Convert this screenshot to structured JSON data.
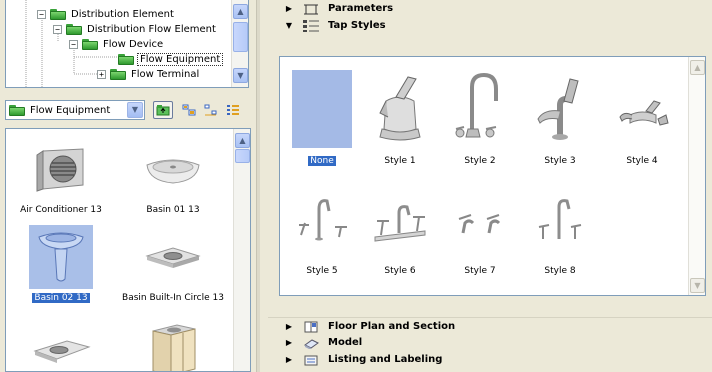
{
  "tree": {
    "items": [
      {
        "label": "Distribution Element",
        "expander": "−"
      },
      {
        "label": "Distribution Flow Element",
        "expander": "−"
      },
      {
        "label": "Flow Device",
        "expander": "−"
      },
      {
        "label": "Flow Equipment",
        "expander": ""
      },
      {
        "label": "Flow Terminal",
        "expander": "+"
      }
    ],
    "selected": "Flow Equipment"
  },
  "toolbar": {
    "folder_combo_value": "Flow Equipment",
    "icons": [
      "folder-up-icon",
      "large-icons-view-icon",
      "small-icons-view-icon",
      "list-view-icon"
    ]
  },
  "library": {
    "items": [
      {
        "label": "Air Conditioner 13",
        "icon": "air-conditioner-icon"
      },
      {
        "label": "Basin 01 13",
        "icon": "basin-icon"
      },
      {
        "label": "Basin 02 13",
        "icon": "pedestal-basin-icon"
      },
      {
        "label": "Basin Built-In Circle 13",
        "icon": "built-in-basin-icon"
      },
      {
        "label": "",
        "icon": "counter-basin-icon"
      },
      {
        "label": "",
        "icon": "cabinet-basin-icon"
      }
    ],
    "selected": "Basin 02 13"
  },
  "panels": {
    "parameters": "Parameters",
    "tap_styles": "Tap Styles",
    "floor_plan": "Floor Plan and Section",
    "model": "Model",
    "listing": "Listing and Labeling"
  },
  "tap_styles": {
    "items": [
      {
        "label": "None",
        "icon": "none-swatch"
      },
      {
        "label": "Style 1",
        "icon": "tap-style-1-icon"
      },
      {
        "label": "Style 2",
        "icon": "tap-style-2-icon"
      },
      {
        "label": "Style 3",
        "icon": "tap-style-3-icon"
      },
      {
        "label": "Style 4",
        "icon": "tap-style-4-icon"
      },
      {
        "label": "Style 5",
        "icon": "tap-style-5-icon"
      },
      {
        "label": "Style 6",
        "icon": "tap-style-6-icon"
      },
      {
        "label": "Style 7",
        "icon": "tap-style-7-icon"
      },
      {
        "label": "Style 8",
        "icon": "tap-style-8-icon"
      }
    ],
    "selected": "None"
  },
  "colors": {
    "selection": "#316ac5",
    "selection_light": "#a4bae6",
    "border": "#7f9db9",
    "window_bg": "#ece9d8"
  }
}
